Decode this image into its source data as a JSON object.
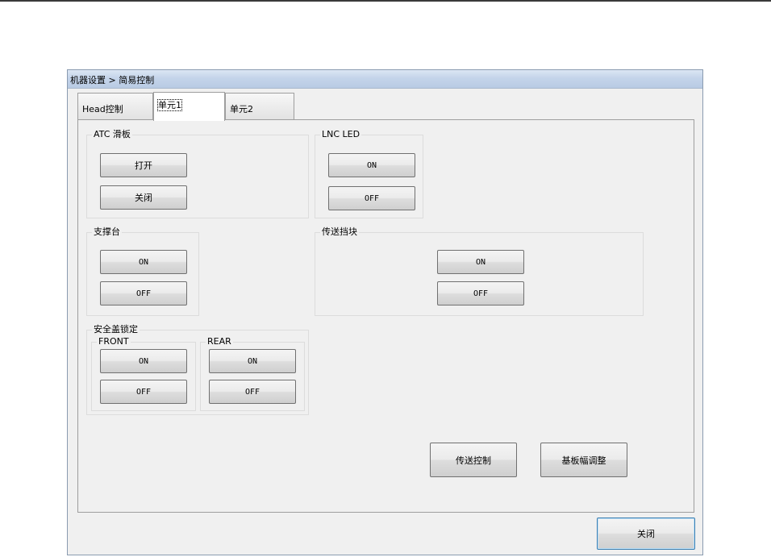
{
  "window": {
    "breadcrumb": "机器设置 > 简易控制"
  },
  "tabs": [
    {
      "label": "Head控制",
      "active": false
    },
    {
      "label": "单元1",
      "active": true
    },
    {
      "label": "单元2",
      "active": false
    }
  ],
  "groups": {
    "atc": {
      "label": "ATC 滑板",
      "open": "打开",
      "close": "关闭"
    },
    "lnc": {
      "label": "LNC LED",
      "on": "ON",
      "off": "OFF"
    },
    "support": {
      "label": "支撑台",
      "on": "ON",
      "off": "OFF"
    },
    "conveyor_stop": {
      "label": "传送挡块",
      "on": "ON",
      "off": "OFF"
    },
    "safety": {
      "label": "安全盖锁定",
      "front": {
        "label": "FRONT",
        "on": "ON",
        "off": "OFF"
      },
      "rear": {
        "label": "REAR",
        "on": "ON",
        "off": "OFF"
      }
    }
  },
  "actions": {
    "conveyor_control": "传送控制",
    "width_adjust": "基板幅调整"
  },
  "footer": {
    "close": "关闭"
  }
}
